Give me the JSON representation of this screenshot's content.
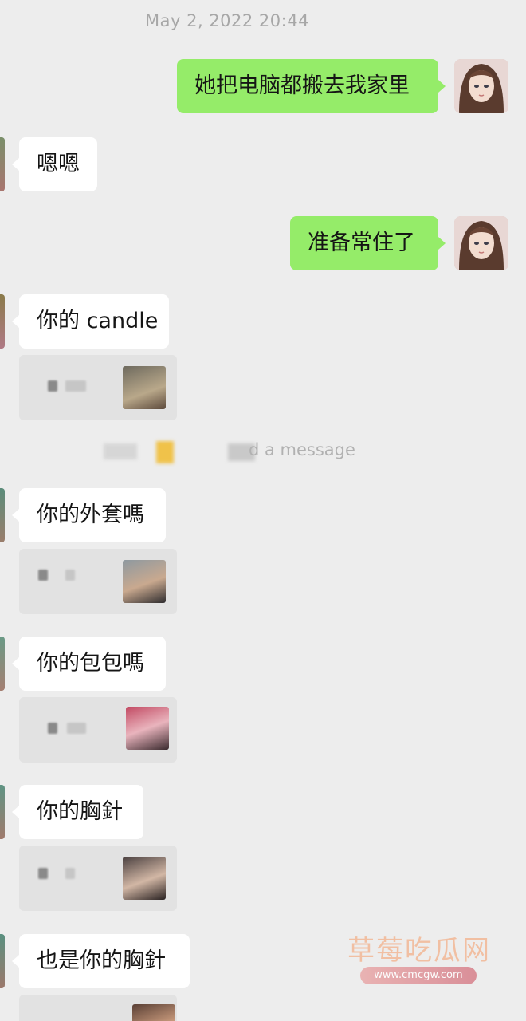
{
  "timestamp": "May 2, 2022 20:44",
  "messages": {
    "m1": "她把电脑都搬去我家里",
    "m2": "嗯嗯",
    "m3": "准备常住了",
    "m4": "你的 candle",
    "m5": "你的外套嗎",
    "m6": "你的包包嗎",
    "m7": "你的胸針",
    "m8": "也是你的胸針"
  },
  "system_notice": {
    "text": "d a message"
  },
  "watermark": {
    "title": "草莓吃瓜网",
    "url": "www.cmcgw.com"
  },
  "colors": {
    "background": "#ededed",
    "self_bubble": "#95ec69",
    "other_bubble": "#ffffff",
    "quote_bg": "#e2e2e2"
  }
}
